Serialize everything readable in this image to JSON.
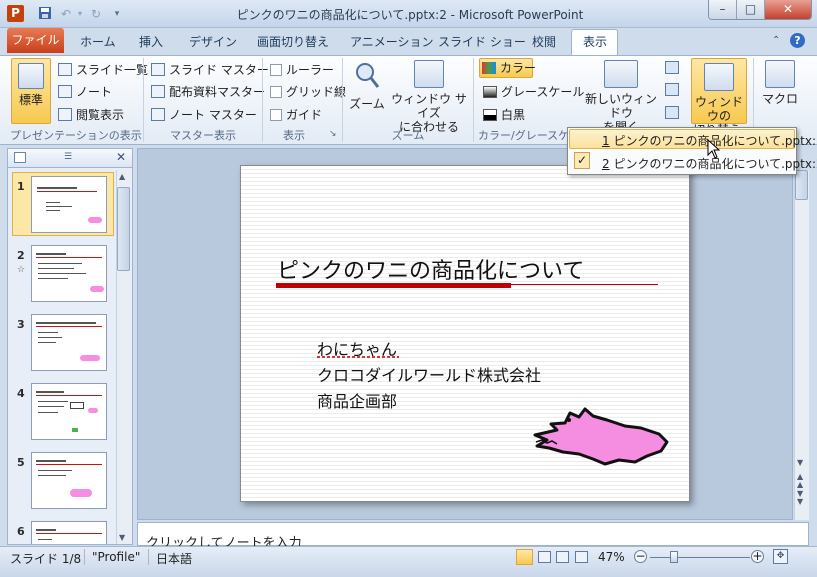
{
  "window": {
    "title": "ピンクのワニの商品化について.pptx:2 - Microsoft PowerPoint",
    "app_icon_letter": "P",
    "controls": {
      "minimize": "–",
      "maximize": "□",
      "close": "✕"
    }
  },
  "ribbon_tabs": {
    "file": "ファイル",
    "home": "ホーム",
    "insert": "挿入",
    "design": "デザイン",
    "transitions": "画面切り替え",
    "animations": "アニメーション",
    "slideshow": "スライド ショー",
    "review": "校閲",
    "view": "表示"
  },
  "ribbon": {
    "presentation_views": {
      "standard": "標準",
      "slide_list": "スライド一覧",
      "notes": "ノート",
      "reading": "閲覧表示",
      "label": "プレゼンテーションの表示"
    },
    "master_views": {
      "slide_master": "スライド マスター",
      "handout_master": "配布資料マスター",
      "notes_master": "ノート マスター",
      "label": "マスター表示"
    },
    "show": {
      "ruler": "ルーラー",
      "gridlines": "グリッド線",
      "guides": "ガイド",
      "label": "表示"
    },
    "zoom": {
      "zoom": "ズーム",
      "fit_line1": "ウィンドウ サイズ",
      "fit_line2": "に合わせる",
      "label": "ズーム"
    },
    "color": {
      "color": "カラー",
      "grayscale": "グレースケール",
      "bw": "白黒",
      "label": "カラー/グレースケー"
    },
    "window": {
      "new_window_line1": "新しいウィンドウ",
      "new_window_line2": "を開く",
      "switch_line1": "ウィンドウの",
      "switch_line2": "切り替え",
      "switch_arrow": "▾"
    },
    "macro": {
      "macro": "マクロ"
    }
  },
  "dropdown": {
    "items": [
      {
        "num": "1",
        "label": "ピンクのワニの商品化について.pptx:1"
      },
      {
        "num": "2",
        "label": "ピンクのワニの商品化について.pptx:2",
        "check": "✓"
      }
    ]
  },
  "thumbnails": {
    "numbers": [
      "1",
      "2",
      "3",
      "4",
      "5",
      "6"
    ],
    "selected": "1"
  },
  "slide": {
    "title": "ピンクのワニの商品化について",
    "lines": [
      "わにちゃん",
      "クロコダイルワールド株式会社",
      "商品企画部"
    ],
    "croc_color": "#f58ee0"
  },
  "notes": {
    "placeholder": "クリックしてノートを入力"
  },
  "status": {
    "slide": "スライド 1/8",
    "theme": "\"Profile\"",
    "language": "日本語",
    "zoom": "47%",
    "zoom_minus": "−",
    "zoom_plus": "+"
  },
  "colors": {
    "accent_file_tab": "#c8401a",
    "title_line_red": "#c00000",
    "selection_yellow": "#fbe19a"
  }
}
